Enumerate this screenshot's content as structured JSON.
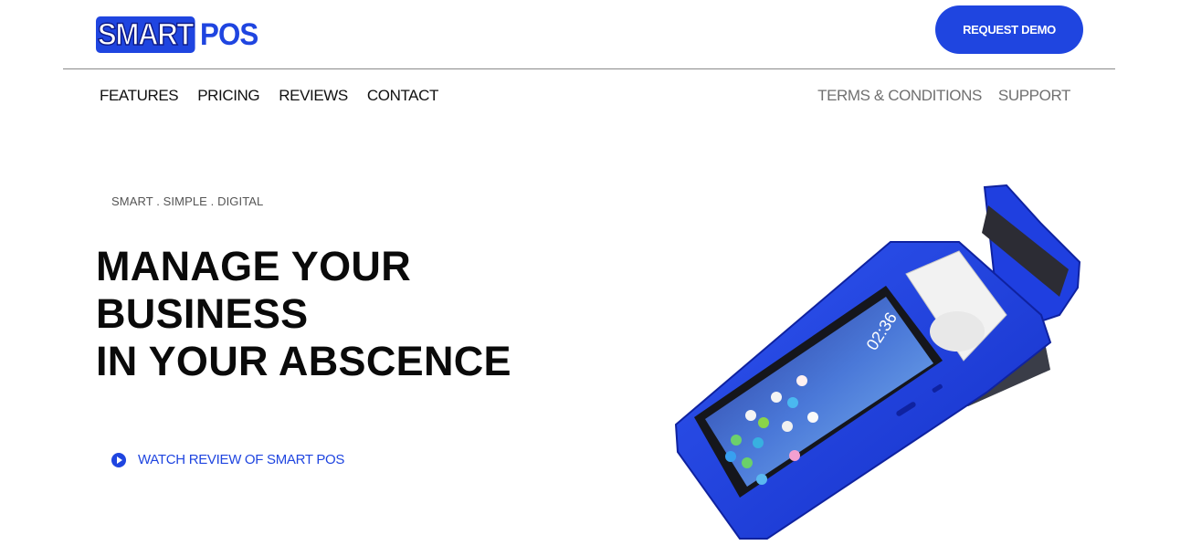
{
  "header": {
    "logo_smart": "SMART",
    "logo_pos": "POS",
    "cta_label": "REQUEST DEMO"
  },
  "nav": {
    "left": [
      "FEATURES",
      "PRICING",
      "REVIEWS",
      "CONTACT"
    ],
    "right": [
      "TERMS & CONDITIONS",
      "SUPPORT"
    ]
  },
  "hero": {
    "tagline": "SMART . SIMPLE . DIGITAL",
    "headline_lines": [
      "MANAGE YOUR",
      "BUSINESS",
      "IN YOUR ABSCENCE"
    ],
    "watch_label": "WATCH REVIEW OF SMART POS"
  },
  "device_screen": {
    "time": "02:36"
  },
  "colors": {
    "brand_blue": "#1f45e0",
    "device_blue": "#1f3fe0",
    "text_dark": "#0a0a0a",
    "nav_muted": "#707070"
  },
  "icons": [
    "play-icon"
  ]
}
